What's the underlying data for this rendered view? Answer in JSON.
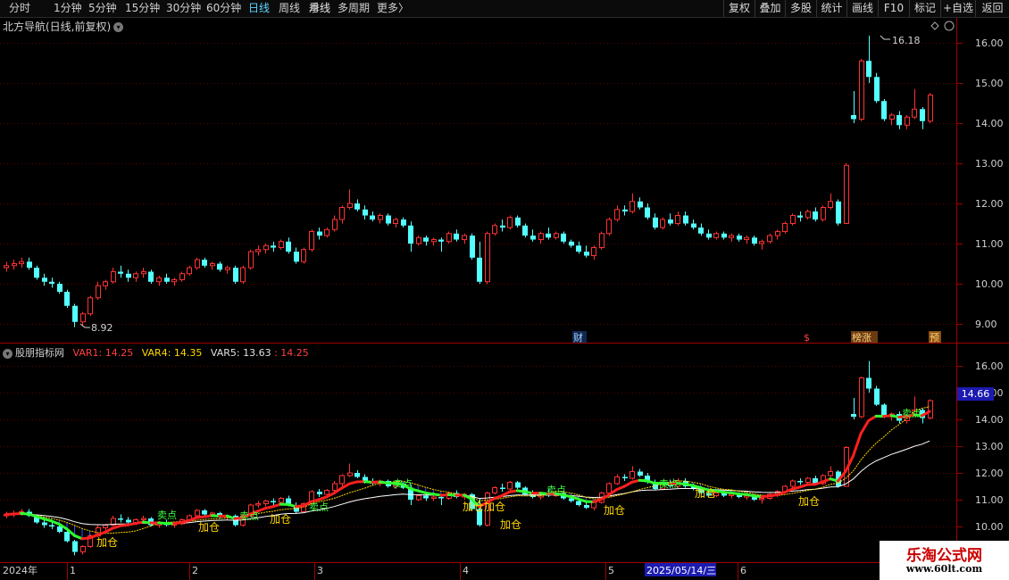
{
  "toolbar": {
    "periods": [
      "分时",
      "1分钟",
      "5分钟",
      "15分钟",
      "30分钟",
      "60分钟",
      "日线",
      "周线",
      "季线",
      "月线",
      "多周期",
      "更多"
    ],
    "active_period": "日线",
    "more_arrow": "〉",
    "right_buttons": [
      "复权",
      "叠加",
      "多股",
      "统计",
      "画线",
      "F10",
      "标记",
      "+自选",
      "返回"
    ]
  },
  "main_panel": {
    "title": "北方导航(日线,前复权)",
    "dropdown_icon": "chevron-down-icon",
    "high_label": "16.18",
    "low_label": "8.92",
    "event_markers": [
      "财",
      "$",
      "榜涨",
      "预"
    ]
  },
  "price_axis": {
    "labels": [
      "16.00",
      "15.00",
      "14.00",
      "13.00",
      "12.00",
      "11.00",
      "10.00",
      "9.00"
    ]
  },
  "indicator_panel": {
    "title": "股朋指标网",
    "var1_label": "VAR1:",
    "var1_value": "14.25",
    "var4_label": "VAR4:",
    "var4_value": "14.35",
    "var5_label": "VAR5:",
    "var5_value": "13.63",
    "extra_value": ": 14.25",
    "axis_labels": [
      "16.00",
      "15.00",
      "14.00",
      "13.00",
      "12.00",
      "11.00",
      "10.00"
    ],
    "current_price": "14.66",
    "signal_jiacang": "加仓",
    "signal_maidian": "卖点"
  },
  "date_axis": {
    "labels": [
      "2024年",
      "1",
      "2",
      "3",
      "4",
      "5",
      "2025/05/14/三",
      "6"
    ]
  },
  "watermark": {
    "title": "乐淘公式网",
    "url": "www.60lt.com"
  },
  "colors": {
    "up": "#ff3232",
    "down": "#54ffff",
    "grid": "#5a0000",
    "active": "#5fd3ff"
  },
  "chart_data": {
    "type": "candlestick",
    "title": "北方导航(日线,前复权)",
    "price_range": [
      8.6,
      16.6
    ],
    "candles": [
      [
        10.4,
        10.55,
        10.3,
        10.45
      ],
      [
        10.45,
        10.6,
        10.35,
        10.5
      ],
      [
        10.5,
        10.65,
        10.4,
        10.55
      ],
      [
        10.55,
        10.65,
        10.35,
        10.4
      ],
      [
        10.4,
        10.45,
        10.1,
        10.15
      ],
      [
        10.15,
        10.25,
        9.95,
        10.05
      ],
      [
        10.05,
        10.15,
        9.9,
        10.0
      ],
      [
        10.0,
        10.05,
        9.75,
        9.8
      ],
      [
        9.8,
        9.85,
        9.4,
        9.45
      ],
      [
        9.45,
        9.5,
        8.92,
        9.05
      ],
      [
        9.05,
        9.3,
        8.95,
        9.25
      ],
      [
        9.25,
        9.7,
        9.2,
        9.65
      ],
      [
        9.65,
        10.05,
        9.6,
        9.95
      ],
      [
        9.95,
        10.1,
        9.85,
        10.05
      ],
      [
        10.05,
        10.4,
        10.0,
        10.3
      ],
      [
        10.3,
        10.45,
        10.15,
        10.25
      ],
      [
        10.25,
        10.35,
        10.05,
        10.15
      ],
      [
        10.15,
        10.3,
        10.05,
        10.25
      ],
      [
        10.25,
        10.4,
        10.15,
        10.3
      ],
      [
        10.3,
        10.35,
        10.0,
        10.05
      ],
      [
        10.05,
        10.2,
        9.95,
        10.15
      ],
      [
        10.15,
        10.25,
        10.0,
        10.05
      ],
      [
        10.05,
        10.15,
        9.95,
        10.1
      ],
      [
        10.1,
        10.3,
        10.05,
        10.25
      ],
      [
        10.25,
        10.45,
        10.2,
        10.4
      ],
      [
        10.4,
        10.65,
        10.35,
        10.6
      ],
      [
        10.6,
        10.65,
        10.4,
        10.45
      ],
      [
        10.45,
        10.55,
        10.35,
        10.5
      ],
      [
        10.5,
        10.55,
        10.3,
        10.35
      ],
      [
        10.35,
        10.45,
        10.25,
        10.4
      ],
      [
        10.4,
        10.45,
        10.0,
        10.05
      ],
      [
        10.05,
        10.45,
        10.0,
        10.4
      ],
      [
        10.4,
        10.85,
        10.35,
        10.8
      ],
      [
        10.8,
        10.95,
        10.7,
        10.85
      ],
      [
        10.85,
        11.0,
        10.75,
        10.95
      ],
      [
        10.95,
        11.05,
        10.8,
        10.9
      ],
      [
        10.9,
        11.1,
        10.85,
        11.05
      ],
      [
        11.05,
        11.15,
        10.75,
        10.8
      ],
      [
        10.8,
        10.9,
        10.5,
        10.55
      ],
      [
        10.55,
        10.9,
        10.5,
        10.85
      ],
      [
        10.85,
        11.35,
        10.8,
        11.3
      ],
      [
        11.3,
        11.4,
        11.1,
        11.2
      ],
      [
        11.2,
        11.4,
        11.15,
        11.35
      ],
      [
        11.35,
        11.7,
        11.3,
        11.6
      ],
      [
        11.6,
        11.95,
        11.5,
        11.9
      ],
      [
        11.9,
        12.35,
        11.85,
        12.0
      ],
      [
        12.0,
        12.1,
        11.8,
        11.85
      ],
      [
        11.85,
        11.95,
        11.6,
        11.7
      ],
      [
        11.7,
        11.8,
        11.55,
        11.6
      ],
      [
        11.6,
        11.75,
        11.5,
        11.7
      ],
      [
        11.7,
        11.75,
        11.45,
        11.5
      ],
      [
        11.5,
        11.65,
        11.4,
        11.6
      ],
      [
        11.6,
        11.65,
        11.4,
        11.45
      ],
      [
        11.45,
        11.55,
        10.8,
        11.0
      ],
      [
        11.0,
        11.2,
        10.95,
        11.15
      ],
      [
        11.15,
        11.2,
        10.95,
        11.05
      ],
      [
        11.05,
        11.15,
        10.95,
        11.1
      ],
      [
        11.1,
        11.15,
        10.8,
        11.05
      ],
      [
        11.05,
        11.3,
        11.0,
        11.25
      ],
      [
        11.25,
        11.35,
        11.05,
        11.1
      ],
      [
        11.1,
        11.25,
        11.0,
        11.2
      ],
      [
        11.2,
        11.25,
        10.6,
        10.65
      ],
      [
        10.65,
        11.05,
        10.0,
        10.05
      ],
      [
        10.05,
        11.3,
        10.0,
        11.25
      ],
      [
        11.25,
        11.5,
        11.2,
        11.45
      ],
      [
        11.45,
        11.6,
        11.3,
        11.4
      ],
      [
        11.4,
        11.7,
        11.35,
        11.65
      ],
      [
        11.65,
        11.7,
        11.4,
        11.45
      ],
      [
        11.45,
        11.5,
        11.15,
        11.2
      ],
      [
        11.2,
        11.35,
        11.05,
        11.1
      ],
      [
        11.1,
        11.3,
        11.0,
        11.25
      ],
      [
        11.25,
        11.4,
        11.1,
        11.15
      ],
      [
        11.15,
        11.3,
        11.1,
        11.25
      ],
      [
        11.25,
        11.3,
        11.0,
        11.05
      ],
      [
        11.05,
        11.1,
        10.9,
        10.95
      ],
      [
        10.95,
        11.05,
        10.75,
        10.8
      ],
      [
        10.8,
        10.95,
        10.65,
        10.7
      ],
      [
        10.7,
        10.95,
        10.6,
        10.9
      ],
      [
        10.9,
        11.3,
        10.85,
        11.25
      ],
      [
        11.25,
        11.65,
        11.2,
        11.6
      ],
      [
        11.6,
        11.95,
        11.55,
        11.85
      ],
      [
        11.85,
        11.95,
        11.7,
        11.8
      ],
      [
        11.8,
        12.25,
        11.75,
        12.05
      ],
      [
        12.05,
        12.15,
        11.85,
        11.9
      ],
      [
        11.9,
        12.0,
        11.6,
        11.65
      ],
      [
        11.65,
        11.75,
        11.35,
        11.4
      ],
      [
        11.4,
        11.65,
        11.35,
        11.6
      ],
      [
        11.6,
        11.75,
        11.45,
        11.5
      ],
      [
        11.5,
        11.8,
        11.45,
        11.7
      ],
      [
        11.7,
        11.8,
        11.45,
        11.5
      ],
      [
        11.5,
        11.6,
        11.35,
        11.4
      ],
      [
        11.4,
        11.5,
        11.2,
        11.25
      ],
      [
        11.25,
        11.35,
        11.1,
        11.15
      ],
      [
        11.15,
        11.3,
        11.1,
        11.25
      ],
      [
        11.25,
        11.3,
        11.1,
        11.15
      ],
      [
        11.15,
        11.25,
        11.05,
        11.2
      ],
      [
        11.2,
        11.25,
        11.05,
        11.1
      ],
      [
        11.1,
        11.2,
        11.0,
        11.15
      ],
      [
        11.15,
        11.2,
        10.95,
        11.0
      ],
      [
        11.0,
        11.1,
        10.85,
        11.05
      ],
      [
        11.05,
        11.25,
        11.0,
        11.2
      ],
      [
        11.2,
        11.35,
        11.1,
        11.3
      ],
      [
        11.3,
        11.55,
        11.25,
        11.5
      ],
      [
        11.5,
        11.75,
        11.45,
        11.7
      ],
      [
        11.7,
        11.8,
        11.55,
        11.65
      ],
      [
        11.65,
        11.85,
        11.6,
        11.8
      ],
      [
        11.8,
        11.9,
        11.55,
        11.6
      ],
      [
        11.6,
        11.95,
        11.55,
        11.9
      ],
      [
        11.9,
        12.25,
        11.85,
        12.05
      ],
      [
        12.05,
        12.1,
        11.45,
        11.5
      ],
      [
        11.5,
        13.0,
        11.5,
        12.95
      ],
      [
        14.2,
        14.8,
        14.0,
        14.1
      ],
      [
        14.1,
        15.6,
        14.05,
        15.55
      ],
      [
        15.55,
        16.18,
        15.0,
        15.15
      ],
      [
        15.15,
        15.25,
        14.5,
        14.55
      ],
      [
        14.55,
        14.6,
        14.05,
        14.1
      ],
      [
        14.1,
        14.25,
        13.95,
        14.2
      ],
      [
        14.2,
        14.3,
        13.85,
        13.95
      ],
      [
        13.95,
        14.2,
        13.85,
        14.15
      ],
      [
        14.15,
        14.85,
        14.1,
        14.35
      ],
      [
        14.35,
        14.4,
        13.85,
        14.05
      ],
      [
        14.05,
        14.75,
        14.0,
        14.7
      ]
    ]
  }
}
